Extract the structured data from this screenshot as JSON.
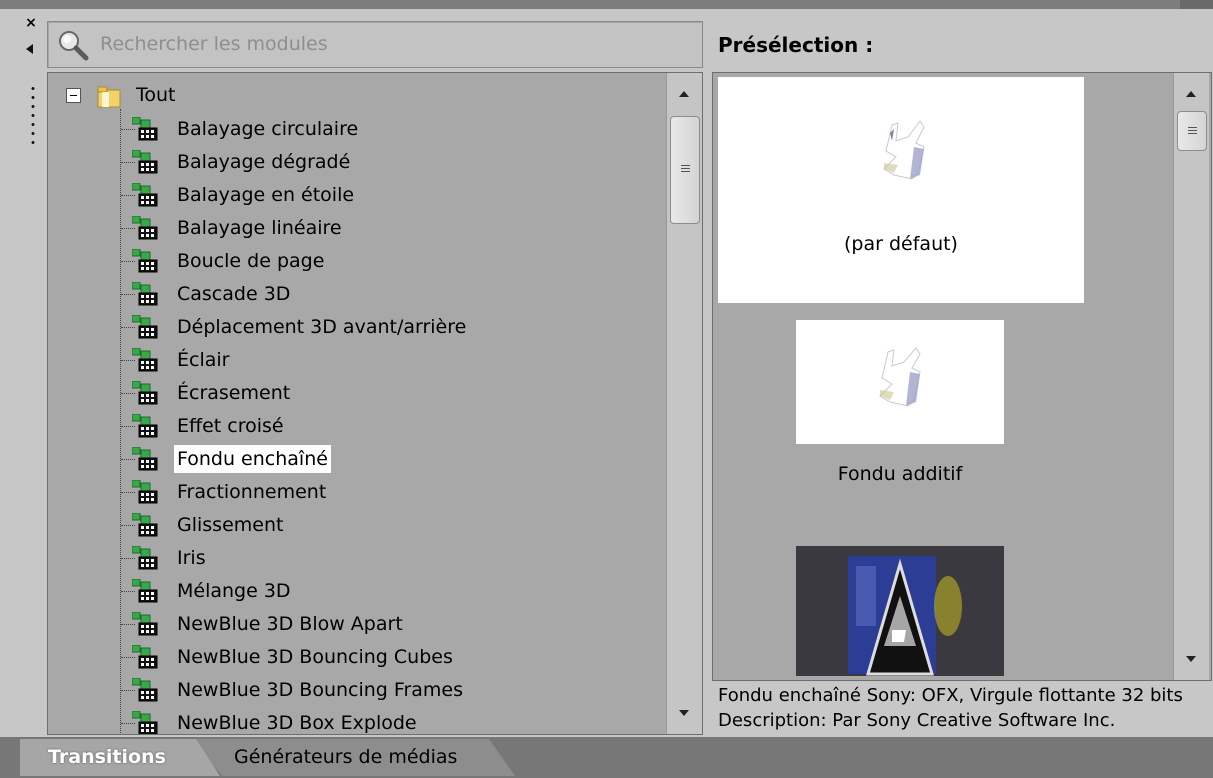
{
  "search": {
    "placeholder": "Rechercher les modules",
    "value": ""
  },
  "tree": {
    "root": "Tout",
    "items": [
      {
        "label": "Balayage circulaire"
      },
      {
        "label": "Balayage dégradé"
      },
      {
        "label": "Balayage en étoile"
      },
      {
        "label": "Balayage linéaire"
      },
      {
        "label": "Boucle de page"
      },
      {
        "label": "Cascade 3D"
      },
      {
        "label": "Déplacement 3D avant/arrière"
      },
      {
        "label": "Éclair"
      },
      {
        "label": "Écrasement"
      },
      {
        "label": "Effet croisé"
      },
      {
        "label": "Fondu enchaîné",
        "selected": true
      },
      {
        "label": "Fractionnement"
      },
      {
        "label": "Glissement"
      },
      {
        "label": "Iris"
      },
      {
        "label": "Mélange 3D"
      },
      {
        "label": "NewBlue 3D Blow Apart"
      },
      {
        "label": "NewBlue 3D Bouncing Cubes"
      },
      {
        "label": "NewBlue 3D Bouncing Frames"
      },
      {
        "label": "NewBlue 3D Box Explode"
      }
    ]
  },
  "presets": {
    "title": "Présélection :",
    "items": [
      {
        "label": "(par défaut)"
      },
      {
        "label": "Fondu additif"
      }
    ]
  },
  "status": {
    "line1": "Fondu enchaîné Sony: OFX, Virgule flottante 32 bits",
    "line2": "Description: Par Sony Creative Software Inc."
  },
  "tabs": [
    {
      "label": "Transitions",
      "active": true
    },
    {
      "label": "Générateurs de médias",
      "active": false
    }
  ],
  "icons": {
    "close": "×",
    "search": "magnifier-icon",
    "folder": "folder-icon",
    "plugin": "plugin-icon"
  }
}
